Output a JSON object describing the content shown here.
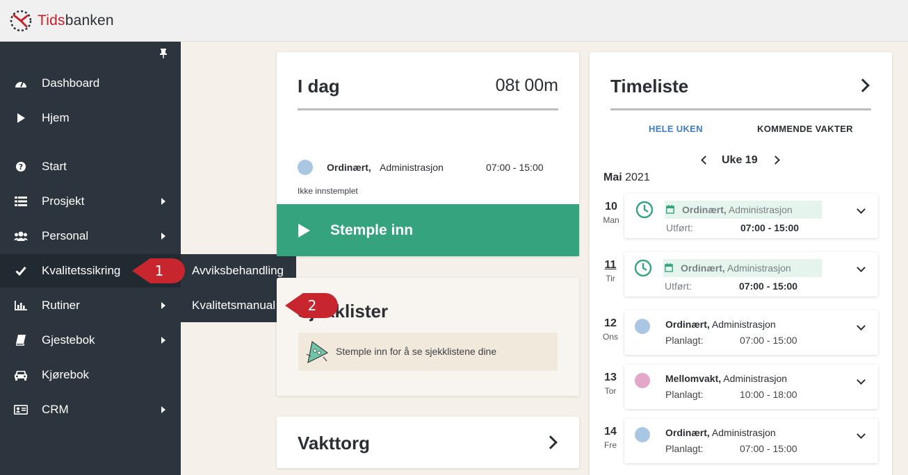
{
  "app": {
    "logo_brand_part": "Tids",
    "logo_rest_part": "banken"
  },
  "sidebar": {
    "items": [
      {
        "label": "Dashboard",
        "icon": "dashboard-icon"
      },
      {
        "label": "Hjem",
        "icon": "play-icon"
      },
      {
        "label": "Start",
        "icon": "question-icon"
      },
      {
        "label": "Prosjekt",
        "icon": "list-icon"
      },
      {
        "label": "Personal",
        "icon": "users-icon"
      },
      {
        "label": "Kvalitetssikring",
        "icon": "check-icon"
      },
      {
        "label": "Rutiner",
        "icon": "bar-chart-icon"
      },
      {
        "label": "Gjestebok",
        "icon": "book-icon"
      },
      {
        "label": "Kjørebok",
        "icon": "car-icon"
      },
      {
        "label": "CRM",
        "icon": "id-card-icon"
      }
    ]
  },
  "flyout": {
    "items": [
      "Avviksbehandling",
      "Kvalitetsmanual"
    ]
  },
  "callouts": [
    "1",
    "2"
  ],
  "idag": {
    "title": "I dag",
    "hours": "08t 00m",
    "shift_type": "Ordinært,",
    "department": "Administrasjon",
    "time": "07:00 - 15:00",
    "status": "Ikke innstemplet",
    "button": "Stemple inn"
  },
  "sjekklister": {
    "title": "Sjekklister",
    "message": "Stemple inn for å se sjekklistene dine"
  },
  "vakttorg": {
    "title": "Vakttorg"
  },
  "timeliste": {
    "title": "Timeliste",
    "tabs": [
      "HELE UKEN",
      "KOMMENDE VAKTER"
    ],
    "week": "Uke 19",
    "month": "Mai",
    "year": "2021",
    "days": [
      {
        "num": "10",
        "name": "Man",
        "type": "Ordinært,",
        "dept": "Administrasjon",
        "status": "Utført:",
        "time": "07:00 - 15:00"
      },
      {
        "num": "11",
        "name": "Tir",
        "type": "Ordinært,",
        "dept": "Administrasjon",
        "status": "Utført:",
        "time": "07:00 - 15:00"
      },
      {
        "num": "12",
        "name": "Ons",
        "type": "Ordinært,",
        "dept": "Administrasjon",
        "status": "Planlagt:",
        "time": "07:00 - 15:00"
      },
      {
        "num": "13",
        "name": "Tor",
        "type": "Mellomvakt,",
        "dept": "Administrasjon",
        "status": "Planlagt:",
        "time": "10:00 - 18:00"
      },
      {
        "num": "14",
        "name": "Fre",
        "type": "Ordinært,",
        "dept": "Administrasjon",
        "status": "Planlagt:",
        "time": "07:00 - 15:00"
      }
    ]
  },
  "colors": {
    "sidebar": "#2c353d",
    "accent_green": "#35a37d",
    "callout_red": "#c8262f",
    "tab_blue": "#3d7cc9",
    "dot_blue": "#a9c6e3",
    "dot_pink": "#e2a7c9"
  }
}
